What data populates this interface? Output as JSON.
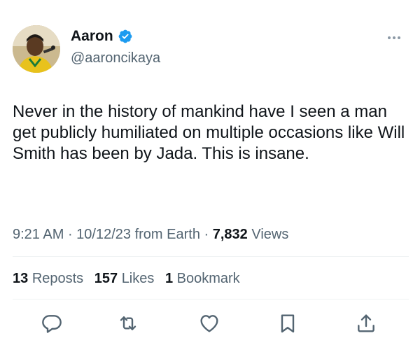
{
  "author": {
    "display_name": "Aaron",
    "handle": "@aaroncikaya",
    "verified": true,
    "avatar_icon": "profile-photo"
  },
  "tweet": {
    "text": "Never in the history of mankind have I seen a man get publicly humiliated on multiple occasions like Will Smith has been by Jada. This is insane."
  },
  "meta": {
    "time": "9:21 AM",
    "date": "10/12/23",
    "sep1": " · ",
    "source": "from Earth",
    "sep2": " · ",
    "views_count": "7,832",
    "views_label": "Views"
  },
  "stats": {
    "reposts_count": "13",
    "reposts_label": "Reposts",
    "likes_count": "157",
    "likes_label": "Likes",
    "bookmarks_count": "1",
    "bookmarks_label": "Bookmark"
  },
  "actions": {
    "reply_icon": "reply-icon",
    "repost_icon": "repost-icon",
    "like_icon": "heart-icon",
    "bookmark_icon": "bookmark-icon",
    "share_icon": "share-icon"
  },
  "colors": {
    "text": "#0f1419",
    "secondary": "#536471",
    "verified": "#1d9bf0",
    "divider": "#eff3f4"
  }
}
